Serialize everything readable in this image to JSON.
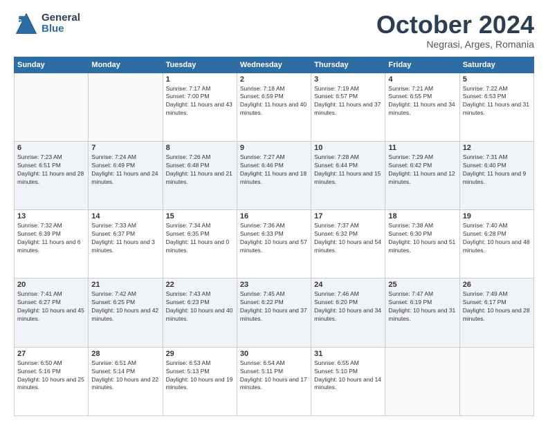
{
  "logo": {
    "text_line1": "General",
    "text_line2": "Blue"
  },
  "header": {
    "month": "October 2024",
    "location": "Negrasi, Arges, Romania"
  },
  "weekdays": [
    "Sunday",
    "Monday",
    "Tuesday",
    "Wednesday",
    "Thursday",
    "Friday",
    "Saturday"
  ],
  "weeks": [
    [
      {
        "day": "",
        "info": ""
      },
      {
        "day": "",
        "info": ""
      },
      {
        "day": "1",
        "info": "Sunrise: 7:17 AM\nSunset: 7:00 PM\nDaylight: 11 hours and 43 minutes."
      },
      {
        "day": "2",
        "info": "Sunrise: 7:18 AM\nSunset: 6:59 PM\nDaylight: 11 hours and 40 minutes."
      },
      {
        "day": "3",
        "info": "Sunrise: 7:19 AM\nSunset: 6:57 PM\nDaylight: 11 hours and 37 minutes."
      },
      {
        "day": "4",
        "info": "Sunrise: 7:21 AM\nSunset: 6:55 PM\nDaylight: 11 hours and 34 minutes."
      },
      {
        "day": "5",
        "info": "Sunrise: 7:22 AM\nSunset: 6:53 PM\nDaylight: 11 hours and 31 minutes."
      }
    ],
    [
      {
        "day": "6",
        "info": "Sunrise: 7:23 AM\nSunset: 6:51 PM\nDaylight: 11 hours and 28 minutes."
      },
      {
        "day": "7",
        "info": "Sunrise: 7:24 AM\nSunset: 6:49 PM\nDaylight: 11 hours and 24 minutes."
      },
      {
        "day": "8",
        "info": "Sunrise: 7:26 AM\nSunset: 6:48 PM\nDaylight: 11 hours and 21 minutes."
      },
      {
        "day": "9",
        "info": "Sunrise: 7:27 AM\nSunset: 6:46 PM\nDaylight: 11 hours and 18 minutes."
      },
      {
        "day": "10",
        "info": "Sunrise: 7:28 AM\nSunset: 6:44 PM\nDaylight: 11 hours and 15 minutes."
      },
      {
        "day": "11",
        "info": "Sunrise: 7:29 AM\nSunset: 6:42 PM\nDaylight: 11 hours and 12 minutes."
      },
      {
        "day": "12",
        "info": "Sunrise: 7:31 AM\nSunset: 6:40 PM\nDaylight: 11 hours and 9 minutes."
      }
    ],
    [
      {
        "day": "13",
        "info": "Sunrise: 7:32 AM\nSunset: 6:39 PM\nDaylight: 11 hours and 6 minutes."
      },
      {
        "day": "14",
        "info": "Sunrise: 7:33 AM\nSunset: 6:37 PM\nDaylight: 11 hours and 3 minutes."
      },
      {
        "day": "15",
        "info": "Sunrise: 7:34 AM\nSunset: 6:35 PM\nDaylight: 11 hours and 0 minutes."
      },
      {
        "day": "16",
        "info": "Sunrise: 7:36 AM\nSunset: 6:33 PM\nDaylight: 10 hours and 57 minutes."
      },
      {
        "day": "17",
        "info": "Sunrise: 7:37 AM\nSunset: 6:32 PM\nDaylight: 10 hours and 54 minutes."
      },
      {
        "day": "18",
        "info": "Sunrise: 7:38 AM\nSunset: 6:30 PM\nDaylight: 10 hours and 51 minutes."
      },
      {
        "day": "19",
        "info": "Sunrise: 7:40 AM\nSunset: 6:28 PM\nDaylight: 10 hours and 48 minutes."
      }
    ],
    [
      {
        "day": "20",
        "info": "Sunrise: 7:41 AM\nSunset: 6:27 PM\nDaylight: 10 hours and 45 minutes."
      },
      {
        "day": "21",
        "info": "Sunrise: 7:42 AM\nSunset: 6:25 PM\nDaylight: 10 hours and 42 minutes."
      },
      {
        "day": "22",
        "info": "Sunrise: 7:43 AM\nSunset: 6:23 PM\nDaylight: 10 hours and 40 minutes."
      },
      {
        "day": "23",
        "info": "Sunrise: 7:45 AM\nSunset: 6:22 PM\nDaylight: 10 hours and 37 minutes."
      },
      {
        "day": "24",
        "info": "Sunrise: 7:46 AM\nSunset: 6:20 PM\nDaylight: 10 hours and 34 minutes."
      },
      {
        "day": "25",
        "info": "Sunrise: 7:47 AM\nSunset: 6:19 PM\nDaylight: 10 hours and 31 minutes."
      },
      {
        "day": "26",
        "info": "Sunrise: 7:49 AM\nSunset: 6:17 PM\nDaylight: 10 hours and 28 minutes."
      }
    ],
    [
      {
        "day": "27",
        "info": "Sunrise: 6:50 AM\nSunset: 5:16 PM\nDaylight: 10 hours and 25 minutes."
      },
      {
        "day": "28",
        "info": "Sunrise: 6:51 AM\nSunset: 5:14 PM\nDaylight: 10 hours and 22 minutes."
      },
      {
        "day": "29",
        "info": "Sunrise: 6:53 AM\nSunset: 5:13 PM\nDaylight: 10 hours and 19 minutes."
      },
      {
        "day": "30",
        "info": "Sunrise: 6:54 AM\nSunset: 5:11 PM\nDaylight: 10 hours and 17 minutes."
      },
      {
        "day": "31",
        "info": "Sunrise: 6:55 AM\nSunset: 5:10 PM\nDaylight: 10 hours and 14 minutes."
      },
      {
        "day": "",
        "info": ""
      },
      {
        "day": "",
        "info": ""
      }
    ]
  ]
}
